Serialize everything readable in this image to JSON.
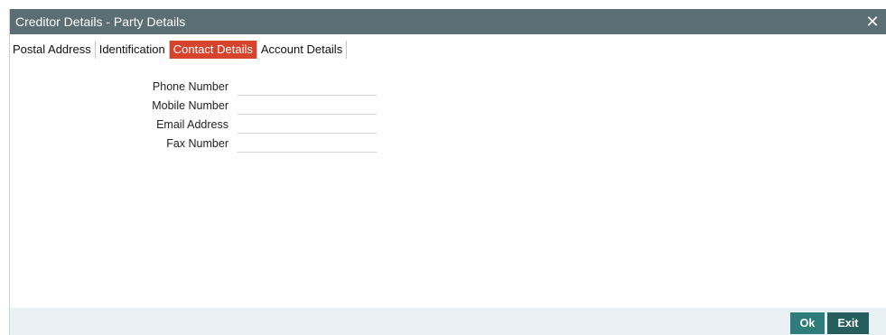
{
  "window": {
    "title": "Creditor Details - Party Details",
    "close_icon": "close-icon",
    "close_glyph": "✕"
  },
  "tabs": [
    {
      "label": "Postal Address",
      "active": false
    },
    {
      "label": "Identification",
      "active": false
    },
    {
      "label": "Contact Details",
      "active": true
    },
    {
      "label": "Account Details",
      "active": false
    }
  ],
  "form": {
    "phone_number": {
      "label": "Phone Number",
      "value": ""
    },
    "mobile_number": {
      "label": "Mobile Number",
      "value": ""
    },
    "email_address": {
      "label": "Email Address",
      "value": ""
    },
    "fax_number": {
      "label": "Fax Number",
      "value": ""
    }
  },
  "footer": {
    "ok_label": "Ok",
    "exit_label": "Exit"
  },
  "colors": {
    "titlebar": "#5a6e73",
    "active_tab": "#d8442b",
    "button": "#2f7d7b",
    "footer": "#eaf1f4"
  }
}
